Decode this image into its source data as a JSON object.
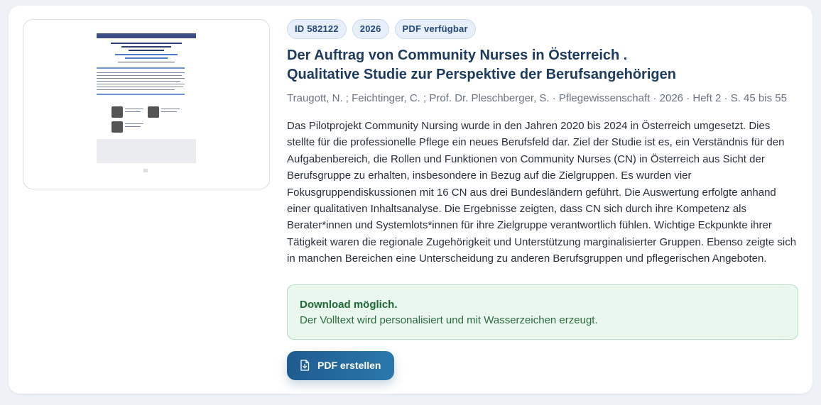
{
  "badges": [
    "ID 582122",
    "2026",
    "PDF verfügbar"
  ],
  "article": {
    "title_line1": "Der Auftrag von Community Nurses in Österreich .",
    "title_line2": "Qualitative Studie zur Perspektive der Berufsangehörigen",
    "meta": "Traugott, N. ; Feichtinger, C. ; Prof. Dr. Pleschberger, S. · Pflegewissenschaft · 2026 · Heft 2 · S. 45 bis 55",
    "abstract": "Das Pilotprojekt Community Nursing wurde in den Jahren 2020 bis 2024 in Österreich umgesetzt. Dies stellte für die professionelle Pflege ein neues Berufsfeld dar. Ziel der Studie ist es, ein Verständnis für den Aufgabenbereich, die Rollen und Funktionen von Community Nurses (CN) in Österreich aus Sicht der Berufsgruppe zu erhalten, insbesondere in Bezug auf die Zielgruppen. Es wurden vier Fokusgruppendiskussionen mit 16 CN aus drei Bundesländern geführt. Die Auswertung erfolgte anhand einer qualitativen Inhaltsanalyse. Die Ergebnisse zeigten, dass CN sich durch ihre Kompetenz als Berater*innen und Systemlots*innen für ihre Zielgruppe verantwortlich fühlen. Wichtige Eckpunkte ihrer Tätigkeit waren die regionale Zugehörigkeit und Unterstützung marginalisierter Gruppen. Ebenso zeigte sich in manchen Bereichen eine Unterscheidung zu anderen Berufsgruppen und pflegerischen Angeboten."
  },
  "thumbnail": {
    "title": "Der Auftrag von Community Nurses in Österreich",
    "subtitle": "Qualitative Studie zur Perspektive der Berufsangehörigen",
    "icon": "pdf-page-preview"
  },
  "notice": {
    "title": "Download möglich.",
    "text": "Der Volltext wird personalisiert und mit Wasserzeichen erzeugt."
  },
  "button": {
    "label": "PDF erstellen",
    "icon": "file-download-icon"
  },
  "colors": {
    "accent": "#1f5b8f",
    "title": "#1d3a5f",
    "notice_bg": "#e9f7ee",
    "notice_text": "#1e6a37",
    "badge_bg": "#e6effa"
  }
}
